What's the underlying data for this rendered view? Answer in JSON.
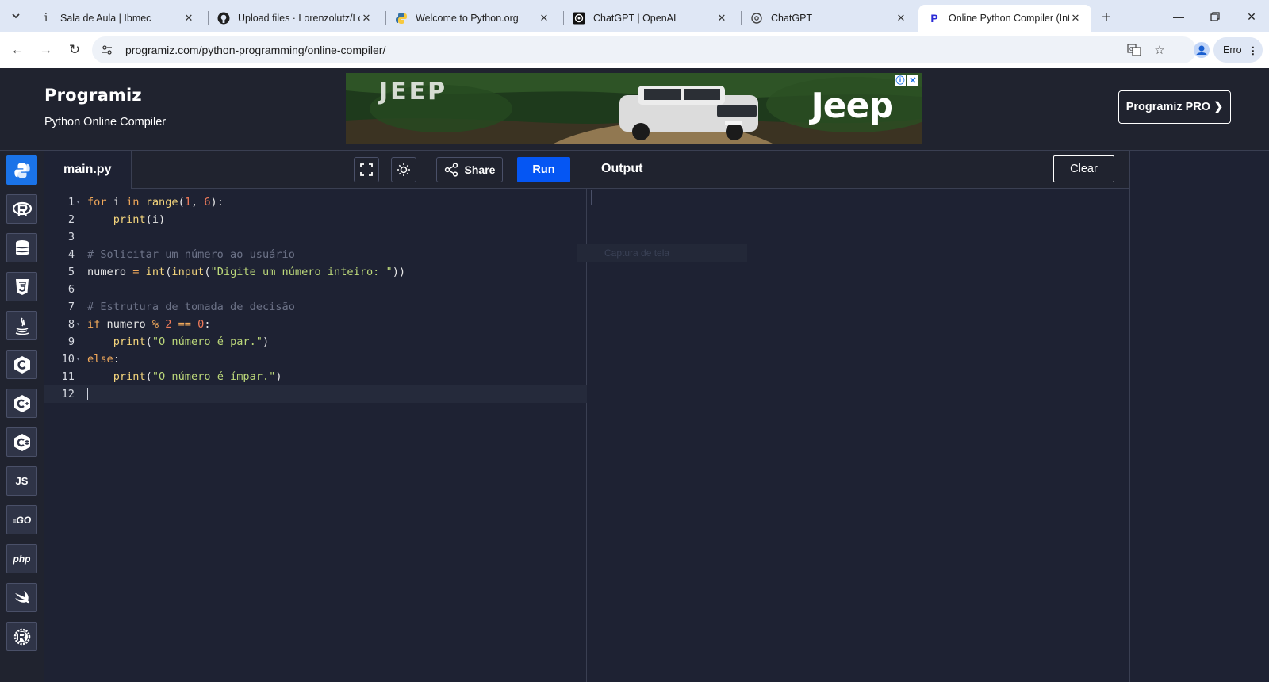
{
  "browser": {
    "tabs": [
      {
        "title": "Sala de Aula | Ibmec",
        "favicon": "ibmec-icon"
      },
      {
        "title": "Upload files · Lorenzolutz/Lo",
        "favicon": "github-icon"
      },
      {
        "title": "Welcome to Python.org",
        "favicon": "python-icon"
      },
      {
        "title": "ChatGPT | OpenAI",
        "favicon": "openai-icon"
      },
      {
        "title": "ChatGPT",
        "favicon": "chatgpt-icon"
      },
      {
        "title": "Online Python Compiler (Inte",
        "favicon": "programiz-icon",
        "active": true
      }
    ],
    "url": "programiz.com/python-programming/online-compiler/",
    "profile_status": "Erro"
  },
  "site": {
    "logo": "Programiz",
    "subtitle": "Python Online Compiler",
    "ad": {
      "headline": "JEEP",
      "brand": "Jeep"
    },
    "pro_button": "Programiz PRO ❯"
  },
  "languages": [
    {
      "name": "python",
      "label": "",
      "active": true
    },
    {
      "name": "r",
      "label": ""
    },
    {
      "name": "sql",
      "label": ""
    },
    {
      "name": "html",
      "label": ""
    },
    {
      "name": "java",
      "label": ""
    },
    {
      "name": "c",
      "label": ""
    },
    {
      "name": "cpp",
      "label": ""
    },
    {
      "name": "csharp",
      "label": ""
    },
    {
      "name": "javascript",
      "label": "JS"
    },
    {
      "name": "go",
      "label": "GO"
    },
    {
      "name": "php",
      "label": "php"
    },
    {
      "name": "swift",
      "label": ""
    },
    {
      "name": "rust",
      "label": ""
    }
  ],
  "editor": {
    "file_name": "main.py",
    "share_label": "Share",
    "run_label": "Run",
    "line_numbers": [
      "1",
      "2",
      "3",
      "4",
      "5",
      "6",
      "7",
      "8",
      "9",
      "10",
      "11",
      "12"
    ],
    "code_lines": [
      "for i in range(1, 6):",
      "    print(i)",
      "",
      "# Solicitar um número ao usuário",
      "numero = int(input(\"Digite um número inteiro: \"))",
      "",
      "# Estrutura de tomada de decisão",
      "if numero % 2 == 0:",
      "    print(\"O número é par.\")",
      "else:",
      "    print(\"O número é ímpar.\")",
      ""
    ]
  },
  "output": {
    "title": "Output",
    "clear_label": "Clear",
    "ghost_text": "Captura de tela"
  },
  "colors": {
    "accent": "#0556f3",
    "background": "#1e2233",
    "header": "#20232f"
  }
}
